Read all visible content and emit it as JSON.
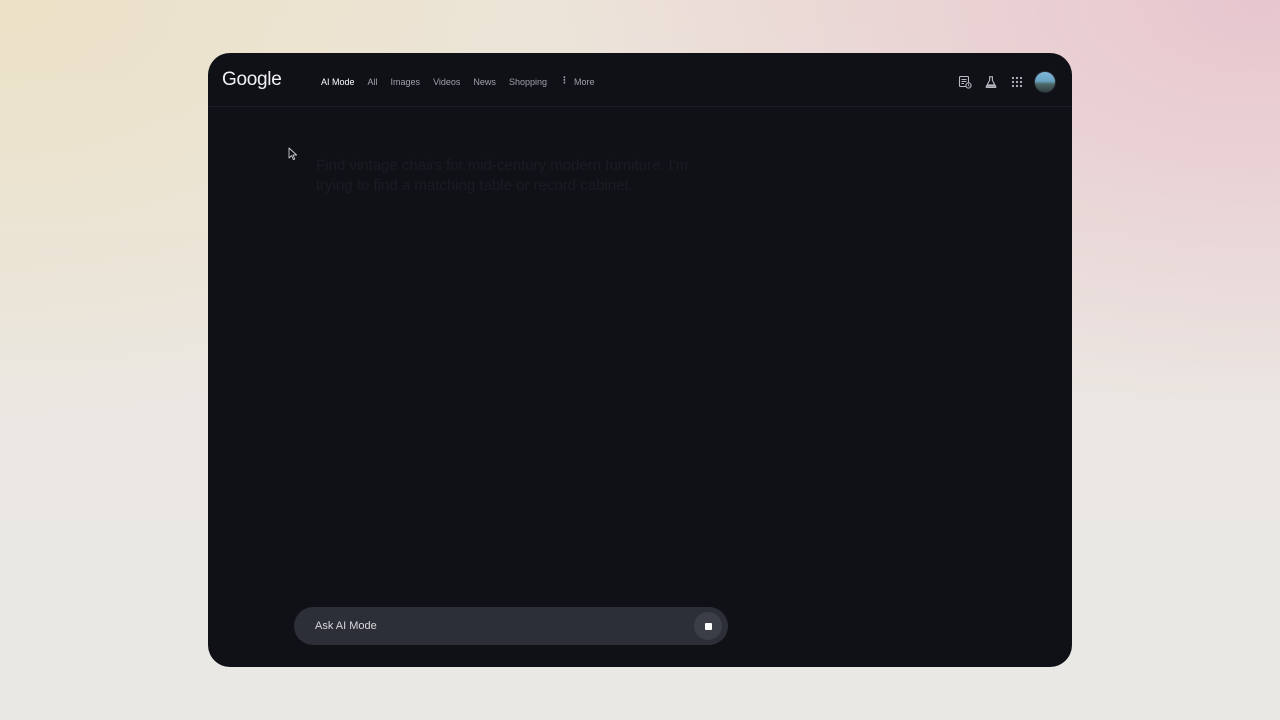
{
  "brand": {
    "logo_text": "Google"
  },
  "nav": {
    "tabs": [
      {
        "label": "AI Mode",
        "active": true
      },
      {
        "label": "All",
        "active": false
      },
      {
        "label": "Images",
        "active": false
      },
      {
        "label": "Videos",
        "active": false
      },
      {
        "label": "News",
        "active": false
      },
      {
        "label": "Shopping",
        "active": false
      }
    ],
    "more_label": "More"
  },
  "toolbar": {
    "icons": [
      "search-history-icon",
      "labs-flask-icon",
      "apps-grid-icon",
      "account-avatar"
    ]
  },
  "main": {
    "faded_query": "Find vintage chairs for mid-century modern furniture. I'm trying to find a matching table or record cabinet."
  },
  "ask_bar": {
    "placeholder": "Ask AI Mode",
    "value": ""
  },
  "colors": {
    "window_bg": "#101117",
    "ask_bar_bg": "#2d2f38",
    "active_tab": "#ffffff",
    "inactive_tab": "#9ea1a9"
  }
}
